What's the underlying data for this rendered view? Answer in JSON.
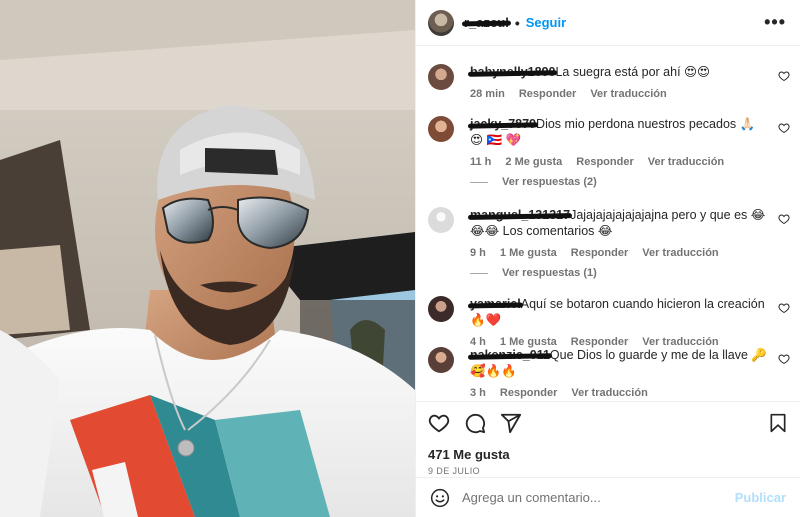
{
  "header": {
    "username": "r_azcul",
    "separator": "•",
    "follow_label": "Seguir",
    "more_icon": "more-horizontal-icon"
  },
  "comments": [
    {
      "user": "babynelly1890",
      "text": "La suegra está por ahí 😍😍",
      "time": "28 min",
      "likes": "",
      "reply_label": "Responder",
      "translate_label": "Ver traducción",
      "avatar_color": "#6b4a3f"
    },
    {
      "user": "jacky_7879",
      "text": "Dios mio perdona nuestros pecados 🙏🏻 😍 🇵🇷 💖",
      "time": "11 h",
      "likes": "2 Me gusta",
      "reply_label": "Responder",
      "translate_label": "Ver traducción",
      "view_replies": "Ver respuestas (2)",
      "avatar_color": "#a0705a"
    },
    {
      "user": "manguel_131317",
      "text": "Jajajajajajajajajna pero y que es 😂😂😂 Los comentarios 😂",
      "time": "9 h",
      "likes": "1 Me gusta",
      "reply_label": "Responder",
      "translate_label": "Ver traducción",
      "view_replies": "Ver respuestas (1)",
      "avatar_color": "#dbdbdb"
    },
    {
      "user": "yamariel",
      "text": "Aquí se botaron cuando hicieron la creación 🔥❤️",
      "time": "4 h",
      "likes": "1 Me gusta",
      "reply_label": "Responder",
      "translate_label": "Ver traducción",
      "avatar_color": "#3b2a28"
    },
    {
      "user": "nakenzie_011",
      "text": "Que Dios lo guarde y me de la llave 🔑🥰🔥🔥",
      "time": "3 h",
      "likes": "",
      "reply_label": "Responder",
      "translate_label": "Ver traducción",
      "avatar_color": "#5a3f39"
    }
  ],
  "actions": {
    "likes": "471 Me gusta",
    "date": "9 DE JULIO",
    "icons": [
      "heart-icon",
      "comment-icon",
      "share-icon",
      "bookmark-icon"
    ]
  },
  "add_comment": {
    "placeholder": "Agrega un comentario...",
    "publish_label": "Publicar",
    "emoji_icon": "emoji-icon"
  },
  "colors": {
    "accent": "#0095f6",
    "publish_disabled": "#b2dffc",
    "muted": "#737373",
    "text": "#262626"
  }
}
